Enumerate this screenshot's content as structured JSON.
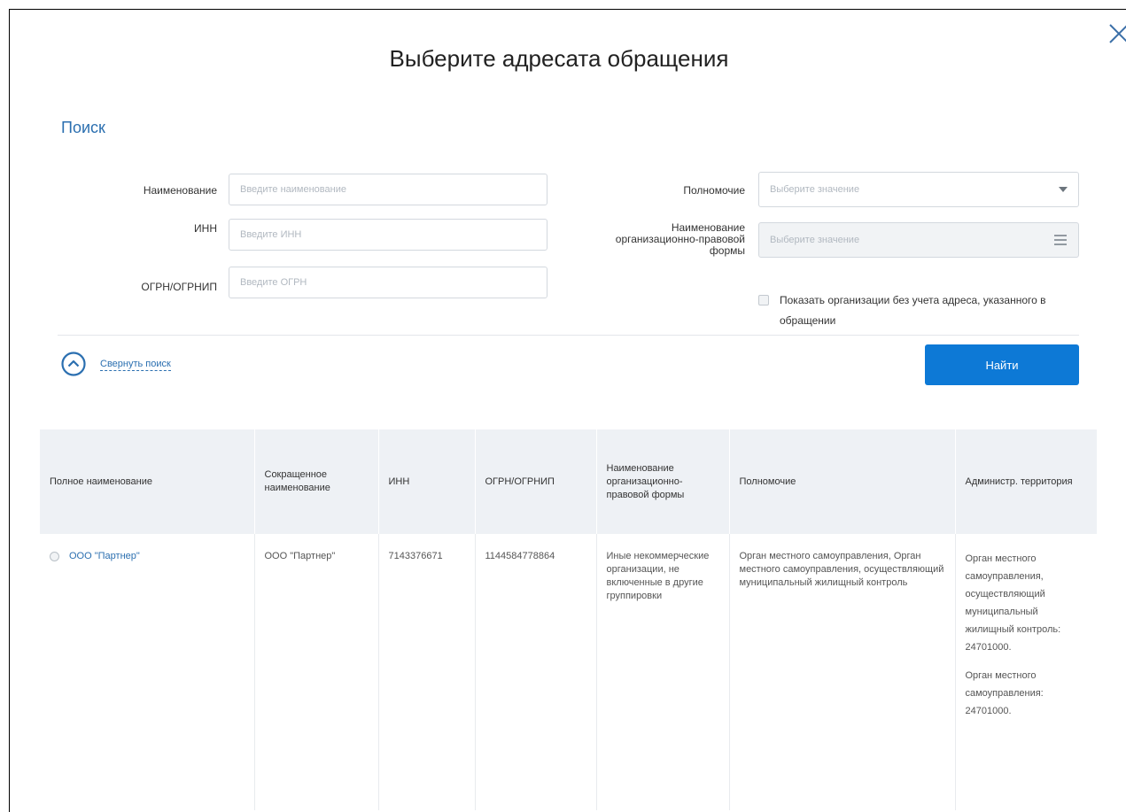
{
  "dialog": {
    "title": "Выберите адресата обращения"
  },
  "search": {
    "heading": "Поиск",
    "name_label": "Наименование",
    "name_placeholder": "Введите наименование",
    "inn_label": "ИНН",
    "inn_placeholder": "Введите ИНН",
    "ogrn_label": "ОГРН/ОГРНИП",
    "ogrn_placeholder": "Введите ОГРН",
    "authority_label": "Полномочие",
    "authority_value": "Выберите значение",
    "legal_form_label": "Наименование организационно-правовой формы",
    "legal_form_value": "Выберите значение",
    "checkbox_label": "Показать организации без учета адреса, указанного в обращении",
    "collapse_label": "Свернуть поиск",
    "find_button": "Найти"
  },
  "table": {
    "headers": [
      "Полное наименование",
      "Сокращенное наименование",
      "ИНН",
      "ОГРН/ОГРНИП",
      "Наименование организационно-правовой формы",
      "Полномочие",
      "Администр. территория"
    ],
    "rows": [
      {
        "full_name": "ООО \"Партнер\"",
        "short_name": "ООО \"Партнер\"",
        "inn": "7143376671",
        "ogrn": "1144584778864",
        "legal_form": "Иные некоммерческие организации, не включенные в другие группировки",
        "authority": "Орган местного самоуправления, Орган местного самоуправления, осуществляющий муниципальный жилищный контроль",
        "territory_1": "Орган местного самоуправления, осуществляющий муниципальный жилищный контроль: 24701000.",
        "territory_2": "Орган местного самоуправления: 24701000."
      }
    ]
  }
}
